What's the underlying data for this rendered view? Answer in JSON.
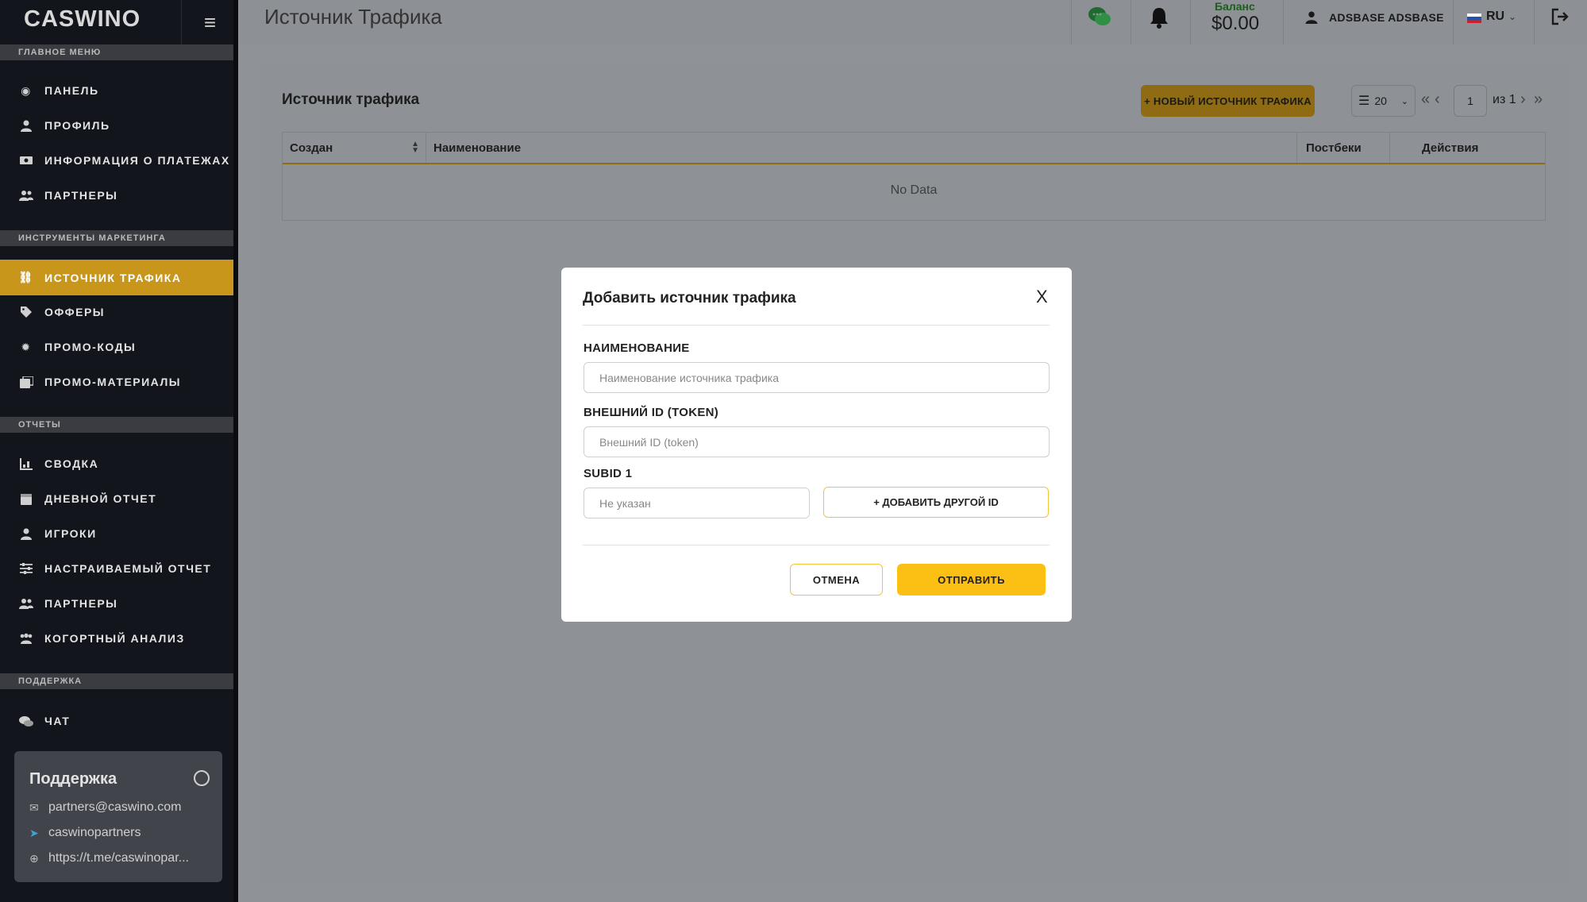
{
  "brand": {
    "logo": "CASWINO",
    "accent": "#c9961c",
    "primary_button": "#fcbf13"
  },
  "header": {
    "title": "Источник Трафика",
    "balance_label": "Баланс",
    "balance_value": "$0.00",
    "user_name": "ADSBASE ADSBASE",
    "language": "RU"
  },
  "sidebar": {
    "sections": {
      "main": "ГЛАВНОЕ МЕНЮ",
      "marketing": "ИНСТРУМЕНТЫ МАРКЕТИНГА",
      "reports": "ОТЧЕТЫ",
      "support": "ПОДДЕРЖКА"
    },
    "main_items": [
      {
        "label": "ПАНЕЛЬ",
        "icon": "dashboard-icon"
      },
      {
        "label": "ПРОФИЛЬ",
        "icon": "user-icon"
      },
      {
        "label": "ИНФОРМАЦИЯ О ПЛАТЕЖАХ",
        "icon": "money-icon"
      },
      {
        "label": "ПАРТНЕРЫ",
        "icon": "users-icon"
      }
    ],
    "marketing_items": [
      {
        "label": "ИСТОЧНИК ТРАФИКА",
        "icon": "link-icon",
        "active": true
      },
      {
        "label": "ОФФЕРЫ",
        "icon": "tags-icon"
      },
      {
        "label": "ПРОМО-КОДЫ",
        "icon": "badge-icon"
      },
      {
        "label": "ПРОМО-МАТЕРИАЛЫ",
        "icon": "images-icon"
      }
    ],
    "report_items": [
      {
        "label": "СВОДКА",
        "icon": "chart-icon"
      },
      {
        "label": "ДНЕВНОЙ ОТЧЕТ",
        "icon": "calendar-icon"
      },
      {
        "label": "ИГРОКИ",
        "icon": "user-icon"
      },
      {
        "label": "НАСТРАИВАЕМЫЙ ОТЧЕТ",
        "icon": "sliders-icon"
      },
      {
        "label": "ПАРТНЕРЫ",
        "icon": "users-icon"
      },
      {
        "label": "КОГОРТНЫЙ АНАЛИЗ",
        "icon": "group-icon"
      }
    ],
    "support_items": [
      {
        "label": "ЧАТ",
        "icon": "comments-icon"
      }
    ],
    "support_card": {
      "title": "Поддержка",
      "email": "partners@caswino.com",
      "telegram": "caswinopartners",
      "url": "https://t.me/caswinopar..."
    }
  },
  "main": {
    "title": "Источник трафика",
    "new_button": "+ НОВЫЙ ИСТОЧНИК ТРАФИКА",
    "page_size": "20",
    "current_page": "1",
    "of_pages": "из 1",
    "table": {
      "columns": [
        "Создан",
        "Наименование",
        "Постбеки",
        "Действия"
      ],
      "empty_text": "No Data"
    }
  },
  "modal": {
    "title": "Добавить источник трафика",
    "close": "X",
    "name_label": "НАИМЕНОВАНИЕ",
    "name_placeholder": "Наименование источника трафика",
    "token_label": "ВНЕШНИЙ ID (TOKEN)",
    "token_placeholder": "Внешний ID (token)",
    "subid_label": "SUBID 1",
    "subid_placeholder": "Не указан",
    "add_id_button": "+ ДОБАВИТЬ ДРУГОЙ ID",
    "cancel_button": "ОТМЕНА",
    "submit_button": "ОТПРАВИТЬ"
  }
}
